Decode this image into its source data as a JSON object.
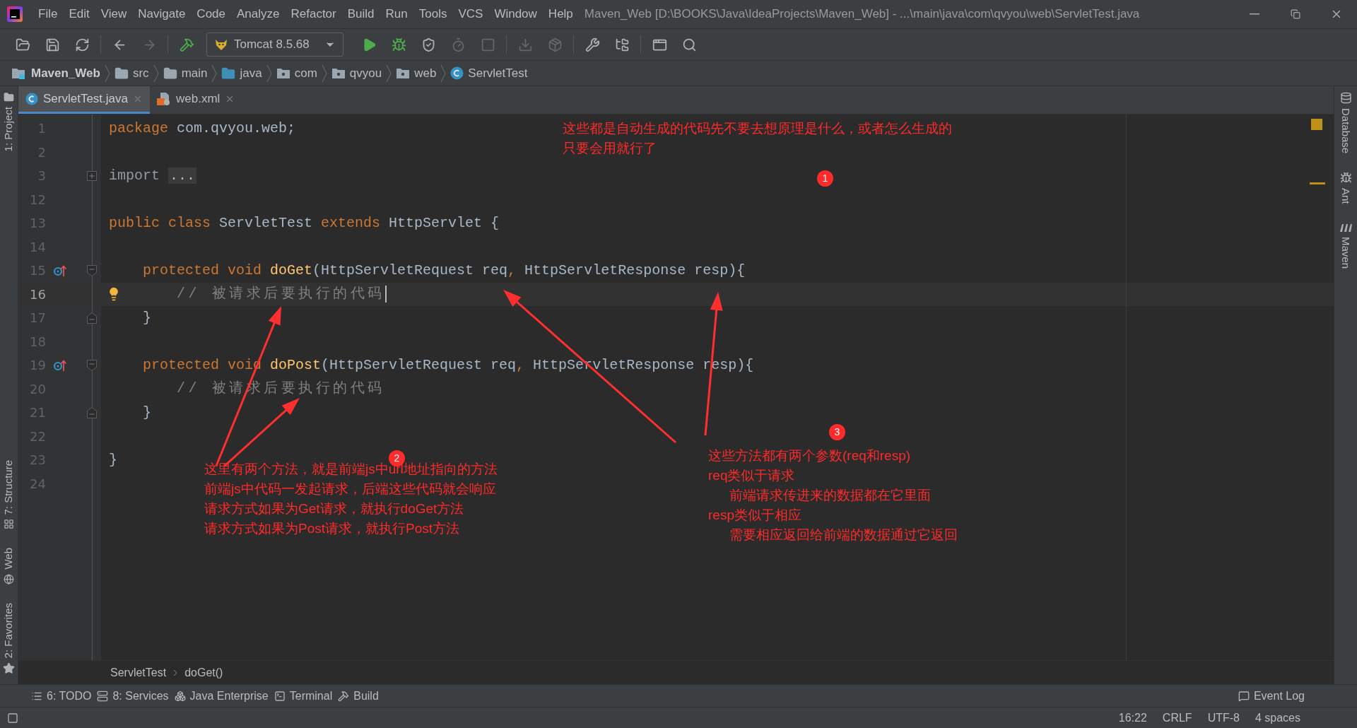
{
  "menu": [
    "File",
    "Edit",
    "View",
    "Navigate",
    "Code",
    "Analyze",
    "Refactor",
    "Build",
    "Run",
    "Tools",
    "VCS",
    "Window",
    "Help"
  ],
  "window": {
    "title": "Maven_Web [D:\\BOOKS\\Java\\IdeaProjects\\Maven_Web] - ...\\main\\java\\com\\qvyou\\web\\ServletTest.java"
  },
  "toolbar": {
    "left": [
      {
        "disabled": false
      },
      {
        "disabled": false
      },
      {
        "disabled": false
      },
      {
        "disabled": false
      },
      {
        "disabled": true
      },
      {
        "disabled": false
      }
    ],
    "run_config": {
      "label": "Tomcat 8.5.68"
    },
    "right": [
      {
        "disabled": false
      },
      {
        "disabled": false
      },
      {
        "disabled": false
      },
      {
        "disabled": true
      },
      {
        "disabled": true
      },
      {
        "disabled": true
      },
      {
        "disabled": true
      },
      {
        "disabled": false
      },
      {
        "disabled": false
      },
      {
        "disabled": false
      },
      {
        "disabled": false
      }
    ]
  },
  "breadcrumb": [
    {
      "label": "Maven_Web",
      "kind": "module"
    },
    {
      "label": "src",
      "kind": "folder"
    },
    {
      "label": "main",
      "kind": "folder"
    },
    {
      "label": "java",
      "kind": "source"
    },
    {
      "label": "com",
      "kind": "package"
    },
    {
      "label": "qvyou",
      "kind": "package"
    },
    {
      "label": "web",
      "kind": "package"
    },
    {
      "label": "ServletTest",
      "kind": "class"
    }
  ],
  "left_stripe": {
    "top": [
      {
        "label": "1: Project"
      }
    ],
    "bottom": [
      {
        "label": "7: Structure"
      },
      {
        "label": "Web"
      },
      {
        "label": "2: Favorites"
      }
    ]
  },
  "right_stripe": [
    {
      "label": "Database"
    },
    {
      "label": "Ant"
    },
    {
      "label": "Maven"
    }
  ],
  "tabs": [
    {
      "label": "ServletTest.java",
      "selected": true
    },
    {
      "label": "web.xml",
      "selected": false
    }
  ],
  "code": [
    {
      "number": "1",
      "current": false,
      "tokens": [
        {
          "text": "package",
          "kind": "keyword"
        },
        {
          "text": " com.qvyou.web;",
          "kind": "plain"
        }
      ]
    },
    {
      "number": "2",
      "current": false
    },
    {
      "number": "3",
      "current": false,
      "fold": {
        "kind": "plus"
      },
      "tokens": [
        {
          "text": "import ",
          "kind": "dim"
        },
        {
          "text": "...",
          "kind": "folded"
        }
      ]
    },
    {
      "number": "12",
      "current": false
    },
    {
      "number": "13",
      "current": false,
      "tokens": [
        {
          "text": "public class",
          "kind": "keyword"
        },
        {
          "text": " ServletTest ",
          "kind": "plain"
        },
        {
          "text": "extends",
          "kind": "keyword"
        },
        {
          "text": " HttpServlet {",
          "kind": "plain"
        }
      ]
    },
    {
      "number": "14",
      "current": false
    },
    {
      "number": "15",
      "current": false,
      "gutter": {
        "kind": "override"
      },
      "fold": {
        "kind": "start"
      },
      "indent": {
        "kind": "single"
      },
      "tokens": [
        {
          "text": "protected void ",
          "kind": "keyword"
        },
        {
          "text": "doGet",
          "kind": "method"
        },
        {
          "text": "(HttpServletRequest req",
          "kind": "plain"
        },
        {
          "text": ",",
          "kind": "keyword"
        },
        {
          "text": " HttpServletResponse resp){",
          "kind": "plain"
        }
      ]
    },
    {
      "number": "16",
      "current": true,
      "gutter": {
        "kind": "bulb"
      },
      "indent": {
        "kind": "double"
      },
      "tokens": [
        {
          "text": "// 被请求后要执行的代码",
          "kind": "comment"
        }
      ]
    },
    {
      "number": "17",
      "current": false,
      "fold": {
        "kind": "end"
      },
      "indent": {
        "kind": "single"
      },
      "tokens": [
        {
          "text": "}",
          "kind": "plain"
        }
      ]
    },
    {
      "number": "18",
      "current": false
    },
    {
      "number": "19",
      "current": false,
      "gutter": {
        "kind": "override"
      },
      "fold": {
        "kind": "start"
      },
      "indent": {
        "kind": "single"
      },
      "tokens": [
        {
          "text": "protected void ",
          "kind": "keyword"
        },
        {
          "text": "doPost",
          "kind": "method"
        },
        {
          "text": "(HttpServletRequest req",
          "kind": "plain"
        },
        {
          "text": ",",
          "kind": "keyword"
        },
        {
          "text": " HttpServletResponse resp){",
          "kind": "plain"
        }
      ]
    },
    {
      "number": "20",
      "current": false,
      "indent": {
        "kind": "double"
      },
      "tokens": [
        {
          "text": "// 被请求后要执行的代码",
          "kind": "comment"
        }
      ]
    },
    {
      "number": "21",
      "current": false,
      "fold": {
        "kind": "end"
      },
      "indent": {
        "kind": "single"
      },
      "tokens": [
        {
          "text": "}",
          "kind": "plain"
        }
      ]
    },
    {
      "number": "22",
      "current": false
    },
    {
      "number": "23",
      "current": false,
      "tokens": [
        {
          "text": "}",
          "kind": "plain"
        }
      ]
    },
    {
      "number": "24",
      "current": false
    }
  ],
  "annotations": [
    {
      "number": "1",
      "lines": [
        {
          "text": "这些都是自动生成的代码先不要去想原理是什么，或者怎么生成的",
          "indent": false
        },
        {
          "text": "只要会用就行了",
          "indent": false
        }
      ]
    },
    {
      "number": "2",
      "lines": [
        {
          "text": "这里有两个方法，就是前端js中url地址指向的方法",
          "indent": false
        },
        {
          "text": "前端js中代码一发起请求，后端这些代码就会响应",
          "indent": false
        },
        {
          "text": "请求方式如果为Get请求，就执行doGet方法",
          "indent": false
        },
        {
          "text": "请求方式如果为Post请求，就执行Post方法",
          "indent": false
        }
      ]
    },
    {
      "number": "3",
      "lines": [
        {
          "text": "这些方法都有两个参数(req和resp)",
          "indent": false
        },
        {
          "text": "req类似于请求",
          "indent": false
        },
        {
          "text": "前端请求传进来的数据都在它里面",
          "indent": true
        },
        {
          "text": "resp类似于相应",
          "indent": false
        },
        {
          "text": "需要相应返回给前端的数据通过它返回",
          "indent": true
        }
      ]
    }
  ],
  "editor_breadcrumb": [
    "ServletTest",
    "doGet()"
  ],
  "tool_windows": [
    {
      "label": "6: TODO",
      "kind": "todo"
    },
    {
      "label": "8: Services",
      "kind": "services"
    },
    {
      "label": "Java Enterprise",
      "kind": "enterprise"
    },
    {
      "label": "Terminal",
      "kind": "terminal"
    },
    {
      "label": "Build",
      "kind": "build"
    }
  ],
  "event_log": "Event Log",
  "status_bar": [
    "16:22",
    "CRLF",
    "UTF-8",
    "4 spaces"
  ]
}
